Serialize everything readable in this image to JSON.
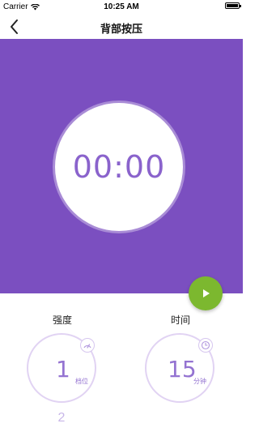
{
  "status_bar": {
    "carrier": "Carrier",
    "time": "10:25 AM",
    "battery_level_percent": 100
  },
  "nav": {
    "title": "背部按压",
    "back_icon": "chevron-left-icon"
  },
  "timer": {
    "display": "00:00",
    "panel_color": "#7b4fc0"
  },
  "play_button": {
    "icon": "play-icon",
    "color": "#7cb82f"
  },
  "intensity": {
    "label": "强度",
    "value": "1",
    "unit": "档位",
    "next_value": "2",
    "badge_icon": "speed-icon"
  },
  "duration": {
    "label": "时间",
    "value": "15",
    "unit": "分钟",
    "badge_icon": "clock-icon"
  }
}
